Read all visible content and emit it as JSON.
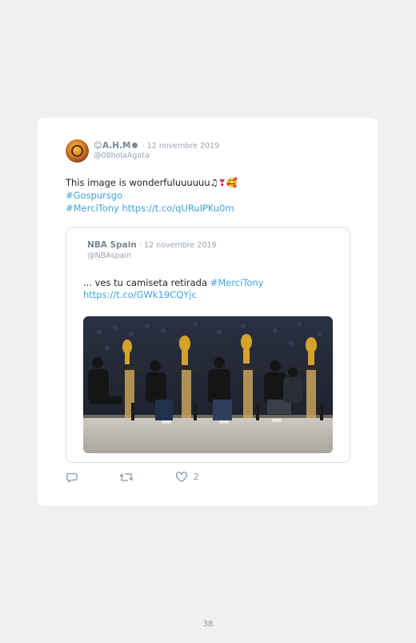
{
  "tweet": {
    "display_name": "☺A.H.M",
    "date": "· 12 novembre 2019",
    "handle": "@08holaAgata",
    "text_line1": "This image is wonderfuluuuuuu♫",
    "text_line1_emojis": "❣🥰",
    "hashtag1": "#Gospursgo",
    "hashtag2": "#MerciTony",
    "link": "https://t.co/qURuIPKu0m"
  },
  "quoted_tweet": {
    "display_name": "NBA Spain",
    "date": "· 12 novembre 2019",
    "handle": "@NBAspain",
    "text": "... ves tu camiseta retirada",
    "hashtag": "#MerciTony",
    "link": "https://t.co/GWk19CQYjc"
  },
  "actions": {
    "reply_icon": "reply-icon",
    "retweet_icon": "retweet-icon",
    "like_icon": "heart-icon",
    "like_count": "2"
  },
  "page_number": "38",
  "colors": {
    "link": "#3fa3e0",
    "muted": "#9aa5b1",
    "background": "#f0f0f0"
  }
}
